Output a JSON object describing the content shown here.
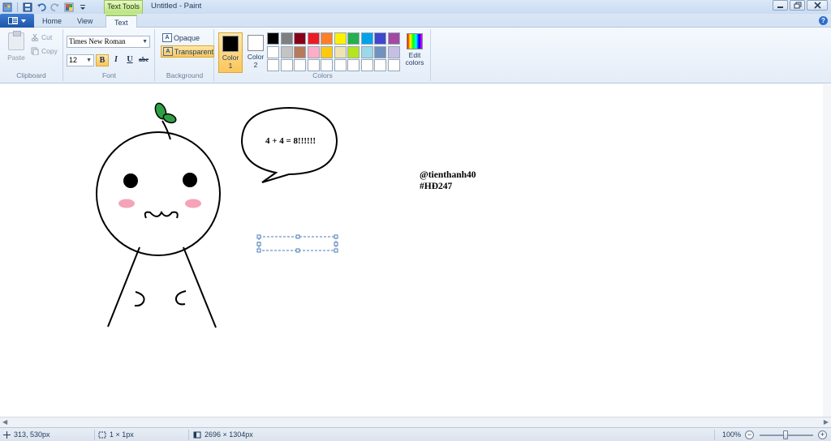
{
  "window": {
    "title": "Untitled - Paint",
    "contextual_tab": "Text Tools"
  },
  "tabs": [
    "Home",
    "View",
    "Text"
  ],
  "ribbon": {
    "clipboard": {
      "label": "Clipboard",
      "paste": "Paste",
      "cut": "Cut",
      "copy": "Copy"
    },
    "font": {
      "label": "Font",
      "family": "Times New Roman",
      "size": "12",
      "bold": "B",
      "italic": "I",
      "underline": "U",
      "strike": "abc"
    },
    "background": {
      "label": "Background",
      "opaque": "Opaque",
      "transparent": "Transparent"
    },
    "colors": {
      "label": "Colors",
      "color1_label": "Color",
      "color1_num": "1",
      "color2_label": "Color",
      "color2_num": "2",
      "color1": "#000000",
      "color2": "#ffffff",
      "edit_label_1": "Edit",
      "edit_label_2": "colors",
      "palette": [
        "#000000",
        "#7f7f7f",
        "#880015",
        "#ed1c24",
        "#ff7f27",
        "#fff200",
        "#22b14c",
        "#00a2e8",
        "#3f48cc",
        "#a349a4",
        "#ffffff",
        "#c3c3c3",
        "#b97a57",
        "#ffaec9",
        "#ffc90e",
        "#efe4b0",
        "#b5e61d",
        "#99d9ea",
        "#7092be",
        "#c8bfe7",
        "#ffffff",
        "#ffffff",
        "#ffffff",
        "#ffffff",
        "#ffffff",
        "#ffffff",
        "#ffffff",
        "#ffffff",
        "#ffffff",
        "#ffffff"
      ]
    }
  },
  "canvas": {
    "bubble_text": "4 + 4 = 8!!!!!!",
    "signature_line1": "@tienthanh40",
    "signature_line2": "#HĐ247"
  },
  "status": {
    "cursor_pos": "313, 530px",
    "selection_size": "1 × 1px",
    "image_size": "2696 × 1304px",
    "zoom": "100%"
  },
  "icons": [
    "app-menu-icon",
    "save-icon",
    "undo-icon",
    "redo-icon",
    "paste-icon",
    "cut-icon",
    "copy-icon",
    "opaque-icon",
    "transparent-icon",
    "help-icon",
    "minimize-icon",
    "maximize-icon",
    "close-icon",
    "cursor-position-icon",
    "selection-size-icon",
    "image-size-icon",
    "zoom-out-icon",
    "zoom-in-icon"
  ]
}
